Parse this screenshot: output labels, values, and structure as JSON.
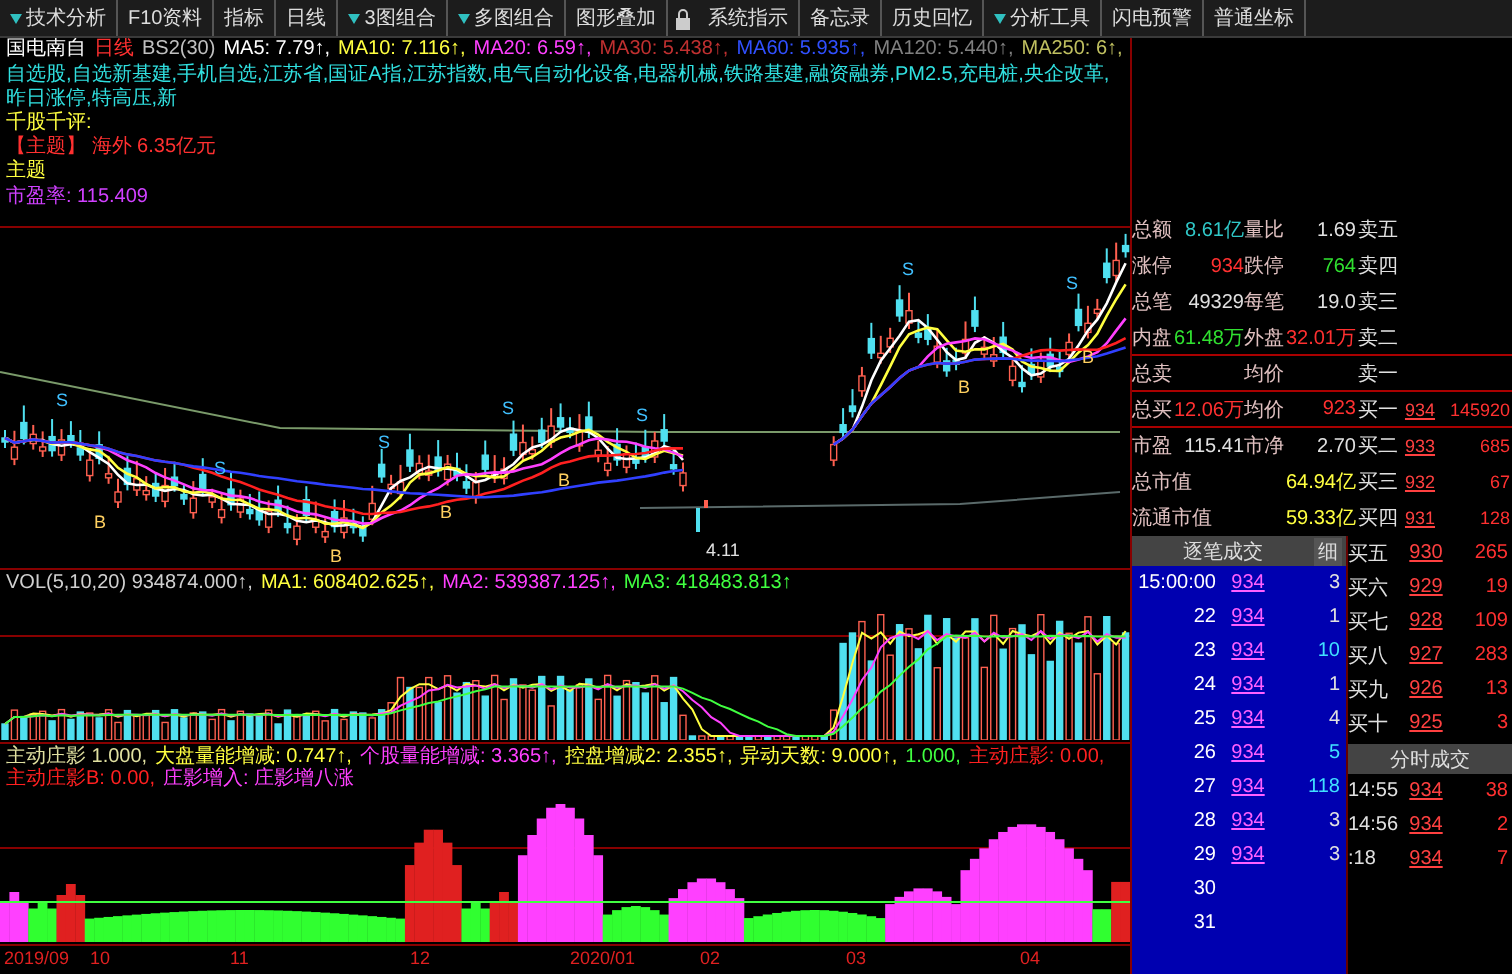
{
  "menu": [
    {
      "kind": "text",
      "label": "技术分析",
      "dropdown": true
    },
    {
      "kind": "text",
      "label": "F10资料",
      "dropdown": false
    },
    {
      "kind": "text",
      "label": "指标",
      "dropdown": false
    },
    {
      "kind": "text",
      "label": "日线",
      "dropdown": false
    },
    {
      "kind": "text",
      "label": "3图组合",
      "dropdown": true
    },
    {
      "kind": "text",
      "label": "多图组合",
      "dropdown": true
    },
    {
      "kind": "text",
      "label": "图形叠加",
      "dropdown": false
    },
    {
      "kind": "icon"
    },
    {
      "kind": "text",
      "label": "系统指示",
      "dropdown": false
    },
    {
      "kind": "text",
      "label": "备忘录",
      "dropdown": false
    },
    {
      "kind": "text",
      "label": "历史回忆",
      "dropdown": false
    },
    {
      "kind": "text",
      "label": "分析工具",
      "dropdown": true
    },
    {
      "kind": "text",
      "label": "闪电预警",
      "dropdown": false
    },
    {
      "kind": "text",
      "label": "普通坐标",
      "dropdown": false
    }
  ],
  "title_line": [
    {
      "text": "国电南自",
      "color": "#ffffff"
    },
    {
      "text": "日线",
      "color": "#ff3030"
    },
    {
      "text": "BS2(30)",
      "color": "#c0c0c0"
    },
    {
      "text": "MA5: 7.79↑,",
      "color": "#ffffff"
    },
    {
      "text": "MA10: 7.116↑,",
      "color": "#ffff40"
    },
    {
      "text": "MA20: 6.59↑,",
      "color": "#ff40ff"
    },
    {
      "text": "MA30: 5.438↑,",
      "color": "#c03030"
    },
    {
      "text": "MA60: 5.935↑,",
      "color": "#3050ff"
    },
    {
      "text": "MA120: 5.440↑,",
      "color": "#808080"
    },
    {
      "text": "MA250: 6↑,",
      "color": "#c0c060"
    }
  ],
  "sectors": "自选股,自选新基建,手机自选,江苏省,国证A指,江苏指数,电气自动化设备,电器机械,铁路基建,融资融券,PM2.5,充电桩,央企改革,昨日涨停,特高压,新",
  "comment_label": "千股千评:",
  "main_business": "【主题】 海外 6.35亿元",
  "theme_label": "主题",
  "pe_text": "市盈率: 115.409",
  "signals": [
    {
      "kind": "sell",
      "label": "S"
    },
    {
      "kind": "buy",
      "label": "B"
    },
    {
      "kind": "sell",
      "label": "S"
    },
    {
      "kind": "buy",
      "label": "B"
    },
    {
      "kind": "sell",
      "label": "S"
    },
    {
      "kind": "buy",
      "label": "B"
    },
    {
      "kind": "sell",
      "label": "S"
    },
    {
      "kind": "buy",
      "label": "B"
    },
    {
      "kind": "sell",
      "label": "S"
    },
    {
      "kind": "sell",
      "label": "S"
    },
    {
      "kind": "buy",
      "label": "B"
    },
    {
      "kind": "sell",
      "label": "S"
    },
    {
      "kind": "buy",
      "label": "B"
    }
  ],
  "low_label": "4.11",
  "volume_header": [
    {
      "text": "VOL(5,10,20) 934874.000↑,",
      "color": "#d0d0d0"
    },
    {
      "text": "MA1: 608402.625↑,",
      "color": "#ffff40"
    },
    {
      "text": "MA2: 539387.125↑,",
      "color": "#ff40ff"
    },
    {
      "text": "MA3: 418483.813↑",
      "color": "#40ff40"
    }
  ],
  "indicator_header": [
    {
      "text": "主动庄影 1.000,",
      "color": "#e0e0a0"
    },
    {
      "text": "大盘量能增减: 0.747↑,",
      "color": "#ffff40"
    },
    {
      "text": "个股量能增减: 3.365↑,",
      "color": "#ff40ff"
    },
    {
      "text": "控盘增减2: 2.355↑,",
      "color": "#ffff40"
    },
    {
      "text": "异动天数: 9.000↑,",
      "color": "#ffff40"
    },
    {
      "text": "1.000,",
      "color": "#40ff40"
    },
    {
      "text": "主动庄影: 0.00,",
      "color": "#ff2020"
    },
    {
      "text": "主动庄影B: 0.00,",
      "color": "#ff2020"
    },
    {
      "text": "庄影增入: 庄影增八涨",
      "color": "#ff40ff"
    }
  ],
  "dates": [
    "2019/09",
    "10",
    "11",
    "12",
    "2020/01",
    "02",
    "03",
    "04"
  ],
  "quote_rows": [
    {
      "kind": "pair",
      "label": "总额",
      "value": {
        "text": "8.61亿",
        "color": "#30c8c8"
      },
      "label2": "量比",
      "value2": {
        "text": "1.69",
        "color": "#e0e0e0"
      },
      "level": "卖五"
    },
    {
      "kind": "pair",
      "label": "涨停",
      "value": {
        "text": "934",
        "color": "#ff3030"
      },
      "label2": "跌停",
      "value2": {
        "text": "764",
        "color": "#30e030"
      },
      "level": "卖四"
    },
    {
      "kind": "pair",
      "label": "总笔",
      "value": {
        "text": "49329",
        "color": "#e0e0e0"
      },
      "label2": "每笔",
      "value2": {
        "text": "19.0",
        "color": "#e0e0e0"
      },
      "level": "卖三"
    },
    {
      "kind": "pair",
      "label": "内盘",
      "value": {
        "text": "61.48万",
        "color": "#30e030"
      },
      "label2": "外盘",
      "value2": {
        "text": "32.01万",
        "color": "#ff3030"
      },
      "level": "卖二"
    },
    {
      "kind": "pair",
      "label": "总卖",
      "label2": "均价",
      "level": "卖一"
    },
    {
      "kind": "pair",
      "label": "总买",
      "value": {
        "text": "12.06万",
        "color": "#ff3030"
      },
      "label2": "均价",
      "value2": {
        "text": "923",
        "color": "#ff3030"
      },
      "level": "买一",
      "price": "934",
      "volume": "145920"
    },
    {
      "kind": "pair",
      "label": "市盈",
      "value": {
        "text": "115.41",
        "color": "#e0e0e0"
      },
      "label2": "市净",
      "value2": {
        "text": "2.70",
        "color": "#e0e0e0"
      },
      "level": "买二",
      "price": "933",
      "volume": "685"
    },
    {
      "kind": "wide",
      "label": "总市值",
      "value2": {
        "text": "64.94亿",
        "color": "#ffff40"
      },
      "level": "买三",
      "price": "932",
      "volume": "67"
    },
    {
      "kind": "wide",
      "label": "流通市值",
      "value2": {
        "text": "59.33亿",
        "color": "#ffff40"
      },
      "level": "买四",
      "price": "931",
      "volume": "128"
    }
  ],
  "ticks_panel": {
    "title": "逐笔成交",
    "button": "细",
    "rows": [
      {
        "time": "15:00:00",
        "price": "934",
        "volume": "3",
        "color": "#e0e0e0"
      },
      {
        "time": "22",
        "price": "934",
        "volume": "1",
        "color": "#e0e0e0"
      },
      {
        "time": "23",
        "price": "934",
        "volume": "10",
        "color": "#40e0ff"
      },
      {
        "time": "24",
        "price": "934",
        "volume": "1",
        "color": "#e0e0e0"
      },
      {
        "time": "25",
        "price": "934",
        "volume": "4",
        "color": "#e0e0e0"
      },
      {
        "time": "26",
        "price": "934",
        "volume": "5",
        "color": "#40e0ff"
      },
      {
        "time": "27",
        "price": "934",
        "volume": "118",
        "color": "#40e0ff"
      },
      {
        "time": "28",
        "price": "934",
        "volume": "3",
        "color": "#e0e0e0"
      },
      {
        "time": "29",
        "price": "934",
        "volume": "3",
        "color": "#e0e0e0"
      },
      {
        "time": "30"
      },
      {
        "time": "31"
      }
    ]
  },
  "buy_levels": [
    {
      "level": "买五",
      "price": "930",
      "volume": "265"
    },
    {
      "level": "买六",
      "price": "929",
      "volume": "19"
    },
    {
      "level": "买七",
      "price": "928",
      "volume": "109"
    },
    {
      "level": "买八",
      "price": "927",
      "volume": "283"
    },
    {
      "level": "买九",
      "price": "926",
      "volume": "13"
    },
    {
      "level": "买十",
      "price": "925",
      "volume": "3"
    }
  ],
  "minute_panel": {
    "title": "分时成交",
    "rows": [
      {
        "time": "14:55",
        "price": "934",
        "volume": "38"
      },
      {
        "time": "14:56",
        "price": "934",
        "volume": "2"
      },
      {
        "time": ":18",
        "price": "934",
        "volume": "7"
      }
    ]
  }
}
